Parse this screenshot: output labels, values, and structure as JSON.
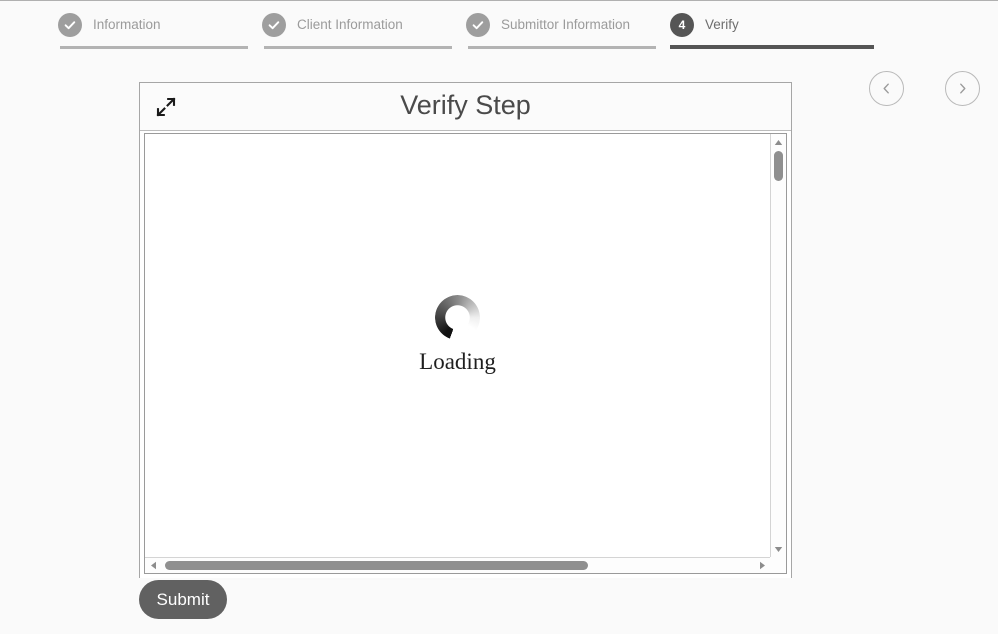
{
  "theme": {
    "page_bg": "#fafafa",
    "accent_dark": "#555555",
    "muted": "#9e9e9e",
    "panel_bg": "#ffffff",
    "submit_bg": "#616161"
  },
  "stepper": {
    "steps": [
      {
        "number": "1",
        "label": "Information",
        "state": "complete",
        "icon": "check-icon"
      },
      {
        "number": "2",
        "label": "Client Information",
        "state": "complete",
        "icon": "check-icon"
      },
      {
        "number": "3",
        "label": "Submittor Information",
        "state": "complete",
        "icon": "check-icon"
      },
      {
        "number": "4",
        "label": "Verify",
        "state": "active",
        "icon": "number"
      }
    ]
  },
  "nav": {
    "prev_icon": "chevron-left-icon",
    "next_icon": "chevron-right-icon"
  },
  "panel": {
    "title": "Verify Step",
    "expand_icon": "expand-icon",
    "content": {
      "state": "loading",
      "loading_text": "Loading",
      "spinner_icon": "spinner-icon"
    },
    "scroll": {
      "vertical": {
        "up_icon": "caret-up-icon",
        "down_icon": "caret-down-icon"
      },
      "horizontal": {
        "left_icon": "caret-left-icon",
        "right_icon": "caret-right-icon"
      }
    }
  },
  "actions": {
    "submit_label": "Submit"
  }
}
